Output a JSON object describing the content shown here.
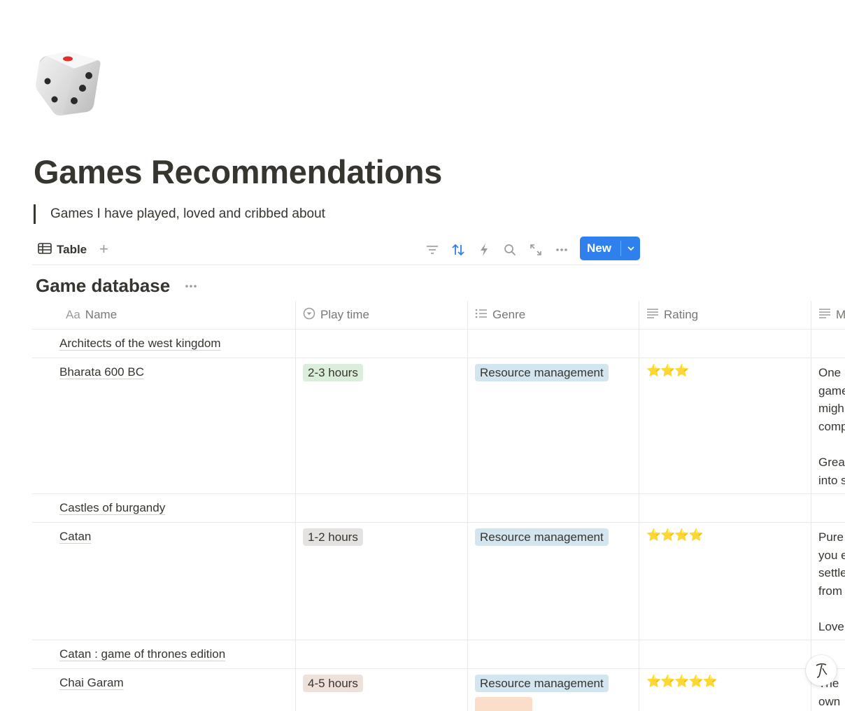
{
  "page": {
    "icon": "dice-icon",
    "title": "Games Recommendations",
    "quote": "Games I have played, loved and cribbed about"
  },
  "viewbar": {
    "tab_label": "Table",
    "add_view_symbol": "+",
    "tools": [
      "filter-icon",
      "sort-icon",
      "automation-icon",
      "search-icon",
      "expand-icon",
      "more-icon"
    ],
    "new_button": "New",
    "accent": "#2f80ed"
  },
  "database": {
    "title": "Game database",
    "columns": [
      {
        "label": "Name",
        "prefix": "Aa"
      },
      {
        "label": "Play time",
        "icon": "select-icon"
      },
      {
        "label": "Genre",
        "icon": "list-icon"
      },
      {
        "label": "Rating",
        "icon": "text-icon"
      },
      {
        "label": "M",
        "icon": "text-icon"
      }
    ],
    "rows": [
      {
        "name": "Architects of the west kingdom",
        "play_time": "",
        "genre": [],
        "rating": "",
        "more": ""
      },
      {
        "name": "Bharata 600 BC",
        "play_time": "2-3 hours",
        "genre": [
          "Resource management"
        ],
        "rating": "⭐⭐⭐",
        "more": "One\ngame\nmigh\ncomp\n\nGrea\ninto s"
      },
      {
        "name": "Castles of burgandy",
        "play_time": "",
        "genre": [],
        "rating": "",
        "more": ""
      },
      {
        "name": "Catan",
        "play_time": "1-2 hours",
        "genre": [
          "Resource management"
        ],
        "rating": "⭐⭐⭐⭐",
        "more": "Pure\nyou e\nsettle\nfrom\n\nLove"
      },
      {
        "name": "Catan : game of thrones edition",
        "play_time": "",
        "genre": [],
        "rating": "",
        "more": ""
      },
      {
        "name": "Chai Garam",
        "play_time": "4-5 hours",
        "genre": [
          "Resource management",
          ""
        ],
        "rating": "⭐⭐⭐⭐⭐",
        "more": "The\nown"
      }
    ]
  },
  "colors": {
    "text": "#37352f",
    "muted": "#787774",
    "border": "#e9e9e7",
    "tag_green": "#dbeddb",
    "tag_gray": "#e3e2e0",
    "tag_brown": "#eee0da",
    "tag_blue": "#d3e5ef"
  },
  "help_button_icon": "help-icon"
}
